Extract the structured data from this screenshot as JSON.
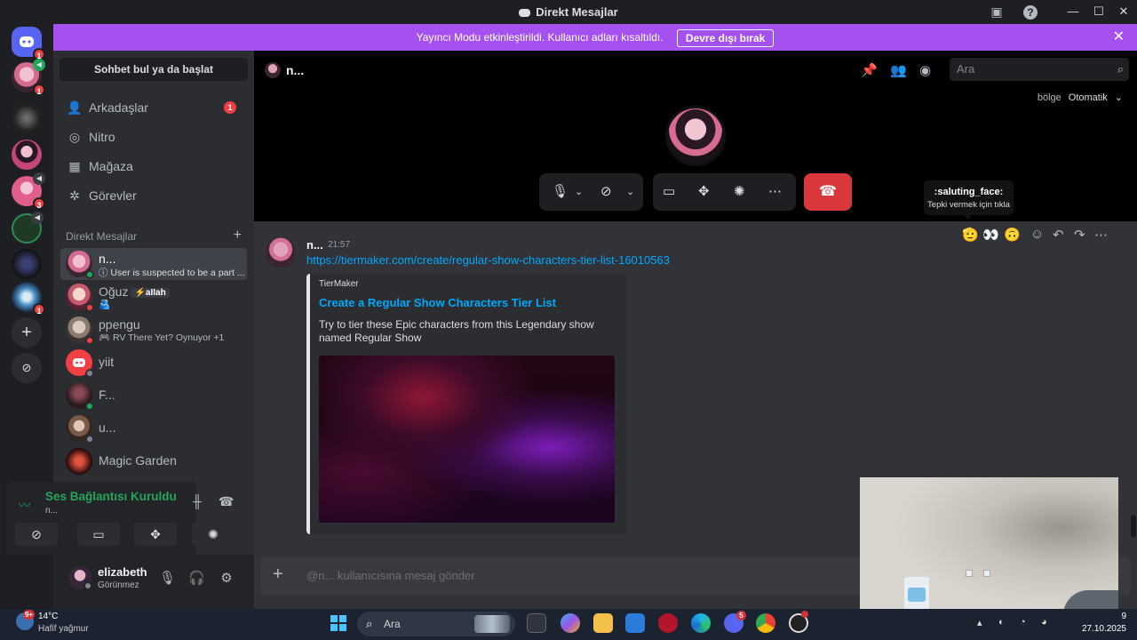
{
  "window": {
    "title": "Direkt Mesajlar",
    "minimize": "—",
    "maximize": "☐",
    "close": "✕"
  },
  "banner": {
    "text": "Yayıncı Modu etkinleştirildi. Kullanıcı adları kısaltıldı.",
    "button": "Devre dışı bırak"
  },
  "guilds": {
    "badge_home": "1",
    "badge_dm1": "1",
    "badge_g5": "3",
    "badge_g9": "1"
  },
  "sidebar": {
    "search": "Sohbet bul ya da başlat",
    "nav": [
      {
        "label": "Arkadaşlar",
        "badge": "1",
        "icon": "friends-icon"
      },
      {
        "label": "Nitro",
        "icon": "nitro-icon"
      },
      {
        "label": "Mağaza",
        "icon": "shop-icon"
      },
      {
        "label": "Görevler",
        "icon": "quests-icon"
      }
    ],
    "dm_header": "Direkt Mesajlar",
    "dms": [
      {
        "name": "n...",
        "sub": "ⓘ User is suspected to be a part ...",
        "status": "online"
      },
      {
        "name": "Oğuz",
        "tag": "⚡aIIah",
        "sub": "🫂",
        "status": "dnd"
      },
      {
        "name": "ppengu",
        "sub": "🎮 RV There Yet? Oynuyor +1",
        "status": "dnd"
      },
      {
        "name": "yiit",
        "status": "offline"
      },
      {
        "name": "F...",
        "status": "online"
      },
      {
        "name": "u...",
        "status": "offline"
      },
      {
        "name": "Magic Garden"
      }
    ]
  },
  "voice": {
    "title": "Ses Bağlantısı Kuruldu",
    "sub": "n..."
  },
  "user": {
    "name": "elizabeth",
    "status": "Görünmez"
  },
  "header": {
    "name": "n...",
    "search_placeholder": "Ara",
    "region_label": "bölge",
    "region_value": "Otomatik"
  },
  "tooltip": {
    "title": ":saluting_face:",
    "sub": "Tepki vermek için tıkla"
  },
  "message": {
    "author": "n...",
    "time": "21:57",
    "link": "https://tiermaker.com/create/regular-show-characters-tier-list-16010563",
    "embed": {
      "provider": "TierMaker",
      "title": "Create a Regular Show Characters Tier List",
      "description": "Try to tier these Epic characters from this Legendary show named Regular Show"
    }
  },
  "composer": {
    "placeholder": "@n... kullanıcısına mesaj gönder"
  },
  "taskbar": {
    "weather_temp": "14°C",
    "weather_desc": "Hafif yağmur",
    "weather_badge": "9+",
    "search": "Ara",
    "discord_badge": "5",
    "date": "27.10.2025",
    "time_fragment": "9"
  },
  "colors": {
    "accent": "#5865f2",
    "banner": "#a451f0",
    "online": "#23a55a",
    "dnd": "#f23f43",
    "link": "#00a8fc",
    "endcall": "#da373c"
  }
}
